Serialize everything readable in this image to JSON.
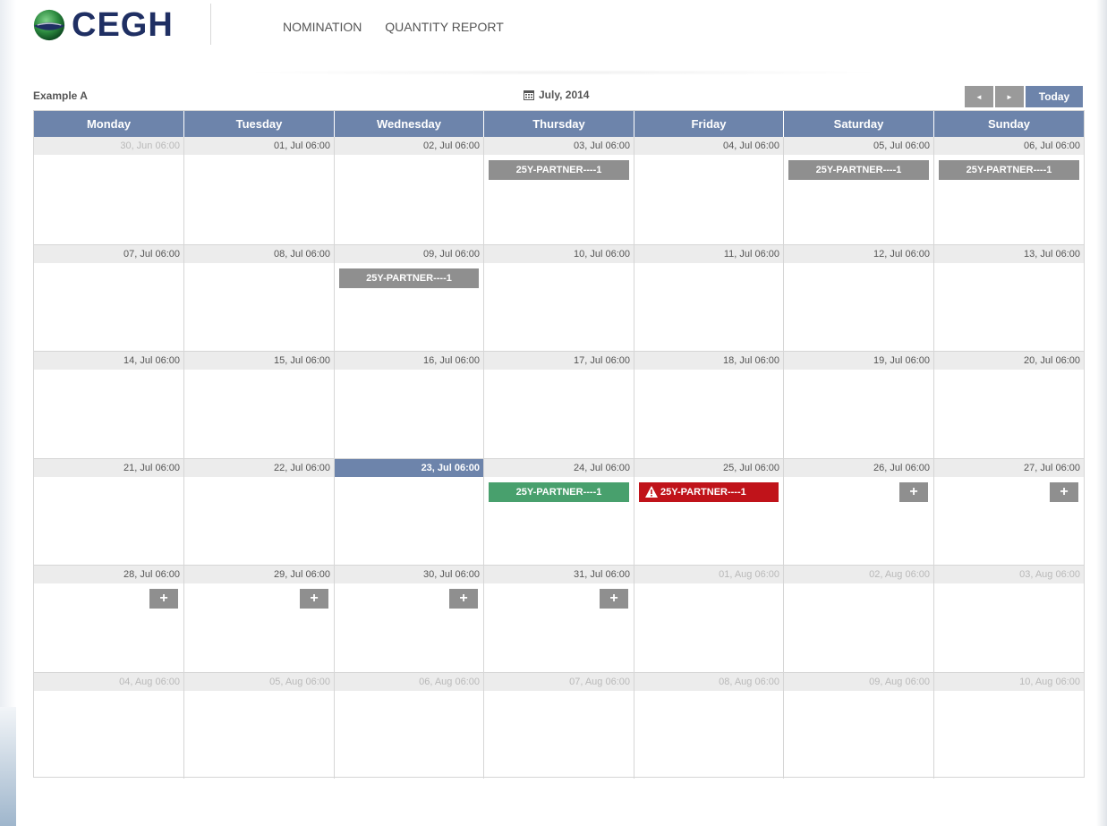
{
  "header": {
    "logo_text": "CEGH",
    "nav": [
      {
        "label": "NOMINATION"
      },
      {
        "label": "QUANTITY REPORT"
      }
    ]
  },
  "toolbar": {
    "title": "Example A",
    "month": "July, 2014",
    "prev_symbol": "◄",
    "next_symbol": "►",
    "today_label": "Today"
  },
  "colors": {
    "accent": "#6d84ab",
    "event_gray": "#8f8f8f",
    "event_green": "#48a06d",
    "event_red": "#c0131a",
    "logo_navy": "#1f2f63"
  },
  "weekdays": [
    "Monday",
    "Tuesday",
    "Wednesday",
    "Thursday",
    "Friday",
    "Saturday",
    "Sunday"
  ],
  "weeks": [
    [
      {
        "label": "30, Jun 06:00",
        "other": true
      },
      {
        "label": "01, Jul 06:00"
      },
      {
        "label": "02, Jul 06:00"
      },
      {
        "label": "03, Jul 06:00",
        "event": {
          "text": "25Y-PARTNER----1",
          "status": "gray"
        }
      },
      {
        "label": "04, Jul 06:00"
      },
      {
        "label": "05, Jul 06:00",
        "event": {
          "text": "25Y-PARTNER----1",
          "status": "gray"
        }
      },
      {
        "label": "06, Jul 06:00",
        "event": {
          "text": "25Y-PARTNER----1",
          "status": "gray"
        }
      }
    ],
    [
      {
        "label": "07, Jul 06:00"
      },
      {
        "label": "08, Jul 06:00"
      },
      {
        "label": "09, Jul 06:00",
        "event": {
          "text": "25Y-PARTNER----1",
          "status": "gray"
        }
      },
      {
        "label": "10, Jul 06:00"
      },
      {
        "label": "11, Jul 06:00"
      },
      {
        "label": "12, Jul 06:00"
      },
      {
        "label": "13, Jul 06:00"
      }
    ],
    [
      {
        "label": "14, Jul 06:00"
      },
      {
        "label": "15, Jul 06:00"
      },
      {
        "label": "16, Jul 06:00"
      },
      {
        "label": "17, Jul 06:00"
      },
      {
        "label": "18, Jul 06:00"
      },
      {
        "label": "19, Jul 06:00"
      },
      {
        "label": "20, Jul 06:00"
      }
    ],
    [
      {
        "label": "21, Jul 06:00"
      },
      {
        "label": "22, Jul 06:00"
      },
      {
        "label": "23, Jul 06:00",
        "today": true
      },
      {
        "label": "24, Jul 06:00",
        "event": {
          "text": "25Y-PARTNER----1",
          "status": "green"
        }
      },
      {
        "label": "25, Jul 06:00",
        "event": {
          "text": "25Y-PARTNER----1",
          "status": "red",
          "icon": "warning-icon"
        }
      },
      {
        "label": "26, Jul 06:00",
        "add": true
      },
      {
        "label": "27, Jul 06:00",
        "add": true
      }
    ],
    [
      {
        "label": "28, Jul 06:00",
        "add": true
      },
      {
        "label": "29, Jul 06:00",
        "add": true
      },
      {
        "label": "30, Jul 06:00",
        "add": true
      },
      {
        "label": "31, Jul 06:00",
        "add": true
      },
      {
        "label": "01, Aug 06:00",
        "other": true
      },
      {
        "label": "02, Aug 06:00",
        "other": true
      },
      {
        "label": "03, Aug 06:00",
        "other": true
      }
    ],
    [
      {
        "label": "04, Aug 06:00",
        "other": true
      },
      {
        "label": "05, Aug 06:00",
        "other": true
      },
      {
        "label": "06, Aug 06:00",
        "other": true
      },
      {
        "label": "07, Aug 06:00",
        "other": true
      },
      {
        "label": "08, Aug 06:00",
        "other": true
      },
      {
        "label": "09, Aug 06:00",
        "other": true
      },
      {
        "label": "10, Aug 06:00",
        "other": true
      }
    ]
  ],
  "add_symbol": "+"
}
